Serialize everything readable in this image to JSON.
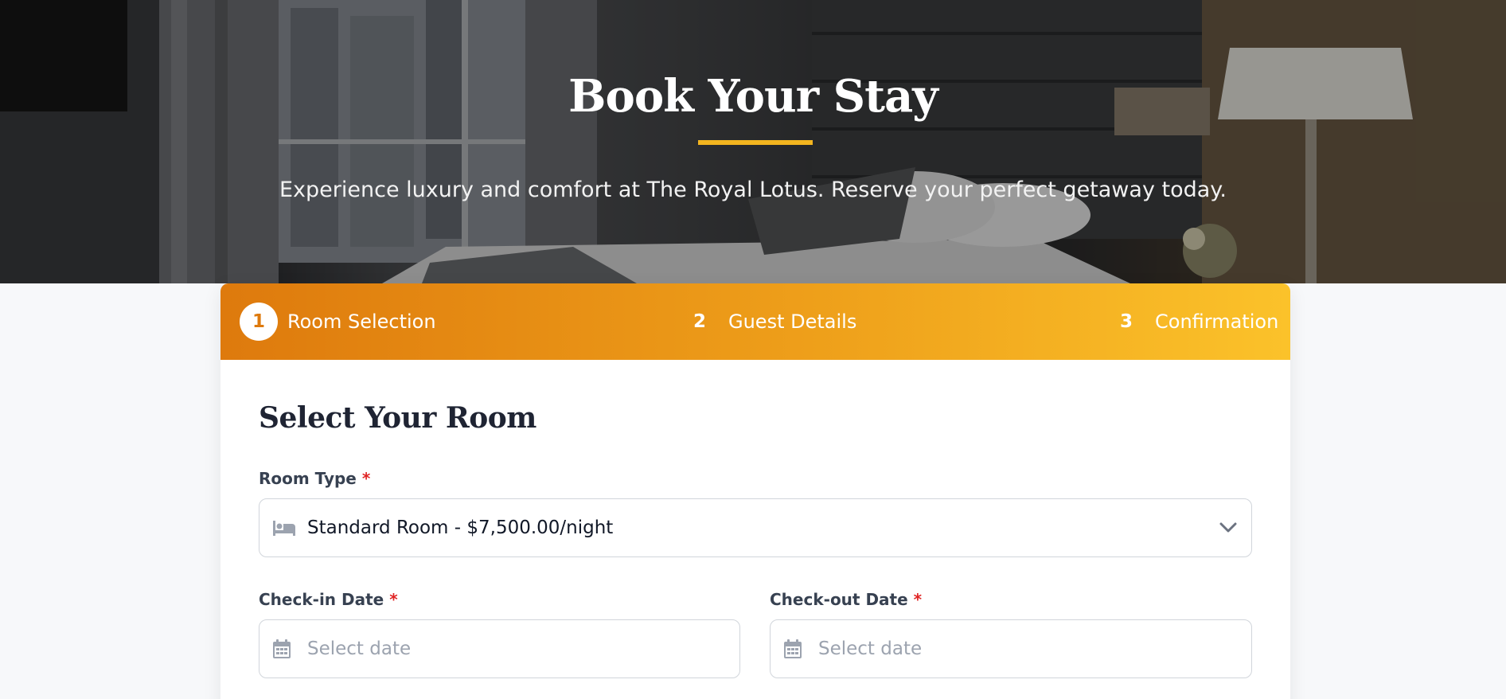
{
  "hero": {
    "title": "Book Your Stay",
    "subtitle": "Experience luxury and comfort at The Royal Lotus. Reserve your perfect getaway today."
  },
  "steps": [
    {
      "number": "1",
      "label": "Room Selection",
      "active": true
    },
    {
      "number": "2",
      "label": "Guest Details",
      "active": false
    },
    {
      "number": "3",
      "label": "Confirmation",
      "active": false
    }
  ],
  "form": {
    "section_title": "Select Your Room",
    "required_mark": "*",
    "room_type": {
      "label": "Room Type",
      "value": "Standard Room - $7,500.00/night",
      "icon": "bed-icon"
    },
    "check_in": {
      "label": "Check-in Date",
      "placeholder": "Select date",
      "icon": "calendar-icon"
    },
    "check_out": {
      "label": "Check-out Date",
      "placeholder": "Select date",
      "icon": "calendar-icon"
    }
  },
  "colors": {
    "accent": "#f3b51f",
    "steps_gradient_start": "#de7a0d",
    "steps_gradient_end": "#fbc22a",
    "required": "#e02424"
  }
}
